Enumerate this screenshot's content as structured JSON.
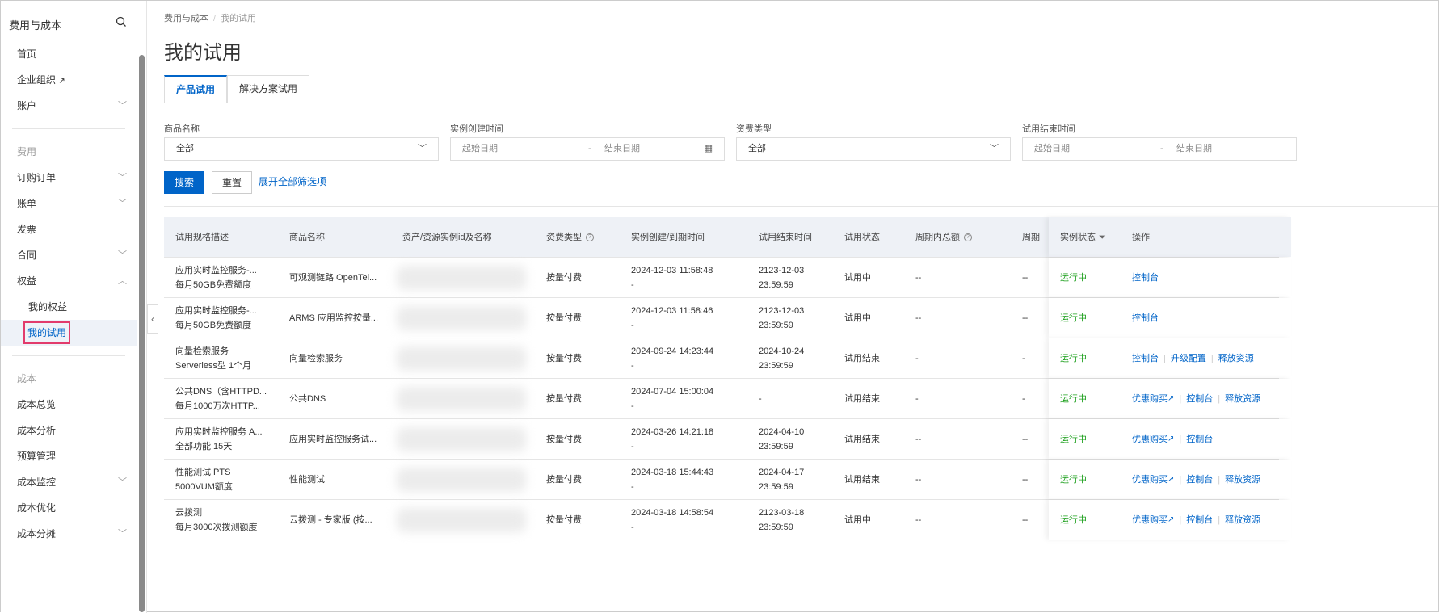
{
  "sidebar": {
    "title": "费用与成本",
    "items": {
      "home": "首页",
      "org": "企业组织",
      "account": "账户",
      "g1": "费用",
      "orders": "订购订单",
      "bills": "账单",
      "invoice": "发票",
      "contract": "合同",
      "rights": "权益",
      "myrights": "我的权益",
      "mytrial": "我的试用",
      "g2": "成本",
      "overview": "成本总览",
      "analysis": "成本分析",
      "budget": "预算管理",
      "monitor": "成本监控",
      "optimize": "成本优化",
      "allocate": "成本分摊"
    }
  },
  "breadcrumb": {
    "root": "费用与成本",
    "current": "我的试用"
  },
  "page_title": "我的试用",
  "tabs": [
    "产品试用",
    "解决方案试用"
  ],
  "filters": {
    "product_label": "商品名称",
    "product_value": "全部",
    "created_label": "实例创建时间",
    "start_ph": "起始日期",
    "end_ph": "结束日期",
    "billing_label": "资费类型",
    "billing_value": "全部",
    "trial_end_label": "试用结束时间",
    "start_ph2": "起始日期",
    "end_ph2": "结束日期"
  },
  "buttons": {
    "search": "搜索",
    "reset": "重置",
    "expand": "展开全部筛选项"
  },
  "columns": [
    "试用规格描述",
    "商品名称",
    "资产/资源实例id及名称",
    "资费类型",
    "实例创建/到期时间",
    "试用结束时间",
    "试用状态",
    "周期内总额",
    "周期",
    "实例状态",
    "操作"
  ],
  "rows": [
    {
      "d1": "应用实时监控服务-...",
      "d2": "每月50GB免费额度",
      "product": "可观测链路 OpenTel...",
      "billing": "按量付费",
      "created": "2024-12-03 11:58:48",
      "expire": "-",
      "end1": "2123-12-03",
      "end2": "23:59:59",
      "status": "试用中",
      "total": "--",
      "period": "--",
      "inst": "运行中",
      "ops": [
        "控制台"
      ],
      "ext": [
        false
      ]
    },
    {
      "d1": "应用实时监控服务-...",
      "d2": "每月50GB免费额度",
      "product": "ARMS 应用监控按量...",
      "billing": "按量付费",
      "created": "2024-12-03 11:58:46",
      "expire": "-",
      "end1": "2123-12-03",
      "end2": "23:59:59",
      "status": "试用中",
      "total": "--",
      "period": "--",
      "inst": "运行中",
      "ops": [
        "控制台"
      ],
      "ext": [
        false
      ]
    },
    {
      "d1": "向量检索服务",
      "d2": "Serverless型 1个月",
      "product": "向量检索服务",
      "billing": "按量付费",
      "created": "2024-09-24 14:23:44",
      "expire": "-",
      "end1": "2024-10-24",
      "end2": "23:59:59",
      "status": "试用结束",
      "total": "-",
      "period": "-",
      "inst": "运行中",
      "ops": [
        "控制台",
        "升级配置",
        "释放资源"
      ],
      "ext": [
        false,
        false,
        false
      ]
    },
    {
      "d1": "公共DNS（含HTTPD...",
      "d2": "每月1000万次HTTP...",
      "product": "公共DNS",
      "billing": "按量付费",
      "created": "2024-07-04 15:00:04",
      "expire": "-",
      "end1": "-",
      "end2": "",
      "status": "试用结束",
      "total": "-",
      "period": "-",
      "inst": "运行中",
      "ops": [
        "优惠购买",
        "控制台",
        "释放资源"
      ],
      "ext": [
        true,
        false,
        false
      ]
    },
    {
      "d1": "应用实时监控服务 A...",
      "d2": "全部功能 15天",
      "product": "应用实时监控服务试...",
      "billing": "按量付费",
      "created": "2024-03-26 14:21:18",
      "expire": "-",
      "end1": "2024-04-10",
      "end2": "23:59:59",
      "status": "试用结束",
      "total": "--",
      "period": "--",
      "inst": "运行中",
      "ops": [
        "优惠购买",
        "控制台"
      ],
      "ext": [
        true,
        false
      ]
    },
    {
      "d1": "性能测试 PTS",
      "d2": "5000VUM额度",
      "product": "性能测试",
      "billing": "按量付费",
      "created": "2024-03-18 15:44:43",
      "expire": "-",
      "end1": "2024-04-17",
      "end2": "23:59:59",
      "status": "试用结束",
      "total": "--",
      "period": "--",
      "inst": "运行中",
      "ops": [
        "优惠购买",
        "控制台",
        "释放资源"
      ],
      "ext": [
        true,
        false,
        false
      ]
    },
    {
      "d1": "云拨测",
      "d2": "每月3000次拨测额度",
      "product": "云拨测 - 专家版 (按...",
      "billing": "按量付费",
      "created": "2024-03-18 14:58:54",
      "expire": "-",
      "end1": "2123-03-18",
      "end2": "23:59:59",
      "status": "试用中",
      "total": "--",
      "period": "--",
      "inst": "运行中",
      "ops": [
        "优惠购买",
        "控制台",
        "释放资源"
      ],
      "ext": [
        true,
        false,
        false
      ]
    }
  ]
}
